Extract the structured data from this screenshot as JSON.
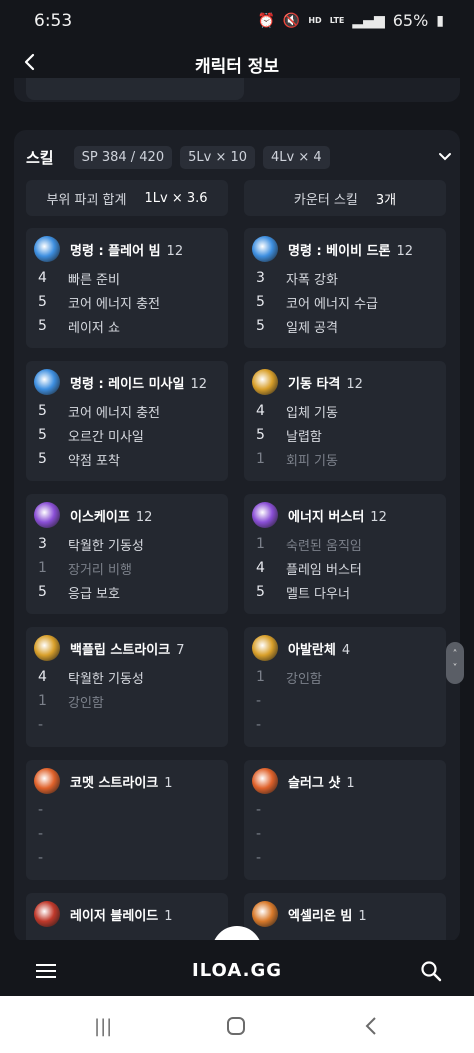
{
  "status": {
    "time": "6:53",
    "net": "HD",
    "lte": "LTE",
    "battery": "65%"
  },
  "header": {
    "title": "캐릭터 정보"
  },
  "skills": {
    "title": "스킬",
    "chips": [
      "SP 384 / 420",
      "5Lv × 10",
      "4Lv × 4"
    ],
    "summary": [
      {
        "label": "부위 파괴 합계",
        "value": "1Lv × 3.6"
      },
      {
        "label": "카운터 스킬",
        "value": "3개"
      }
    ],
    "cards": [
      {
        "name": "명령 : 플레어 빔",
        "level": "12",
        "icon_color": "#3e8fe0",
        "rows": [
          {
            "n": "4",
            "t": "빠른 준비",
            "dim": false
          },
          {
            "n": "5",
            "t": "코어 에너지 충전",
            "dim": false
          },
          {
            "n": "5",
            "t": "레이저 쇼",
            "dim": false
          }
        ]
      },
      {
        "name": "명령 : 베이비 드론",
        "level": "12",
        "icon_color": "#3e8fe0",
        "rows": [
          {
            "n": "3",
            "t": "자폭 강화",
            "dim": false
          },
          {
            "n": "5",
            "t": "코어 에너지 수급",
            "dim": false
          },
          {
            "n": "5",
            "t": "일제 공격",
            "dim": false
          }
        ]
      },
      {
        "name": "명령 : 레이드 미사일",
        "level": "12",
        "icon_color": "#3e8fe0",
        "rows": [
          {
            "n": "5",
            "t": "코어 에너지 충전",
            "dim": false
          },
          {
            "n": "5",
            "t": "오르간 미사일",
            "dim": false
          },
          {
            "n": "5",
            "t": "약점 포착",
            "dim": false
          }
        ]
      },
      {
        "name": "기동 타격",
        "level": "12",
        "icon_color": "#d9a02b",
        "rows": [
          {
            "n": "4",
            "t": "입체 기동",
            "dim": false
          },
          {
            "n": "5",
            "t": "날렵함",
            "dim": false
          },
          {
            "n": "1",
            "t": "회피 기동",
            "dim": true
          }
        ]
      },
      {
        "name": "이스케이프",
        "level": "12",
        "icon_color": "#8a4fd6",
        "rows": [
          {
            "n": "3",
            "t": "탁월한 기동성",
            "dim": false
          },
          {
            "n": "1",
            "t": "장거리 비행",
            "dim": true
          },
          {
            "n": "5",
            "t": "응급 보호",
            "dim": false
          }
        ]
      },
      {
        "name": "에너지 버스터",
        "level": "12",
        "icon_color": "#8a4fd6",
        "rows": [
          {
            "n": "1",
            "t": "숙련된 움직임",
            "dim": true
          },
          {
            "n": "4",
            "t": "플레임 버스터",
            "dim": false
          },
          {
            "n": "5",
            "t": "멜트 다우너",
            "dim": false
          }
        ]
      },
      {
        "name": "백플립 스트라이크",
        "level": "7",
        "icon_color": "#d9a02b",
        "rows": [
          {
            "n": "4",
            "t": "탁월한 기동성",
            "dim": false
          },
          {
            "n": "1",
            "t": "강인함",
            "dim": true
          },
          {
            "n": "-",
            "t": "",
            "dim": true
          }
        ]
      },
      {
        "name": "아발란체",
        "level": "4",
        "icon_color": "#d9a02b",
        "rows": [
          {
            "n": "1",
            "t": "강인함",
            "dim": true
          },
          {
            "n": "-",
            "t": "",
            "dim": true
          },
          {
            "n": "-",
            "t": "",
            "dim": true
          }
        ]
      },
      {
        "name": "코멧 스트라이크",
        "level": "1",
        "icon_color": "#e0622b",
        "rows": [
          {
            "n": "-",
            "t": "",
            "dim": true
          },
          {
            "n": "-",
            "t": "",
            "dim": true
          },
          {
            "n": "-",
            "t": "",
            "dim": true
          }
        ]
      },
      {
        "name": "슬러그 샷",
        "level": "1",
        "icon_color": "#e0622b",
        "rows": [
          {
            "n": "-",
            "t": "",
            "dim": true
          },
          {
            "n": "-",
            "t": "",
            "dim": true
          },
          {
            "n": "-",
            "t": "",
            "dim": true
          }
        ]
      },
      {
        "name": "레이저 블레이드",
        "level": "1",
        "icon_color": "#c0392b",
        "rows": []
      },
      {
        "name": "엑셀리온 빔",
        "level": "1",
        "icon_color": "#d97a2b",
        "rows": []
      }
    ]
  },
  "nav": {
    "logo": "ILOA.GG"
  }
}
